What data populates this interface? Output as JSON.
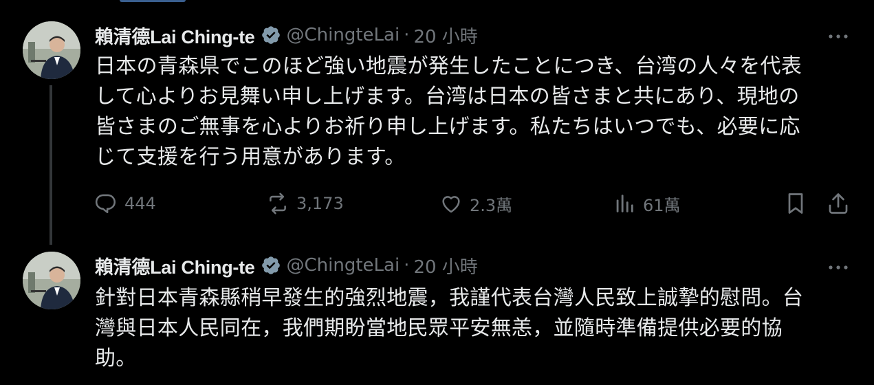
{
  "tweets": [
    {
      "display_name": "賴清德Lai Ching-te",
      "handle": "@ChingteLai",
      "separator": "·",
      "time": "20 小時",
      "lines": [
        "日本の青森県でこのほど強い地震が発生したことにつき、台湾の人々を代表",
        "して心よりお見舞い申し上げます。台湾は日本の皆さまと共にあり、現地の",
        "皆さまのご無事を心よりお祈り申し上げます。私たちはいつでも、必要に応",
        "じて支援を行う用意があります。"
      ],
      "stats": {
        "replies": "444",
        "reposts": "3,173",
        "likes": "2.3萬",
        "views": "61萬"
      }
    },
    {
      "display_name": "賴清德Lai Ching-te",
      "handle": "@ChingteLai",
      "separator": "·",
      "time": "20 小時",
      "lines": [
        "針對日本青森縣稍早發生的強烈地震，我謹代表台灣人民致上誠摯的慰問。台",
        "灣與日本人民同在，我們期盼當地民眾平安無恙，並隨時準備提供必要的協",
        "助。"
      ]
    }
  ],
  "colors": {
    "background": "#000000",
    "text": "#e7e9ea",
    "secondary": "#71767b",
    "verified": "#829aab",
    "thread_line": "#333639"
  },
  "icons": [
    "verified-badge-icon",
    "more-icon",
    "reply-icon",
    "repost-icon",
    "like-icon",
    "views-icon",
    "bookmark-icon",
    "share-icon"
  ]
}
